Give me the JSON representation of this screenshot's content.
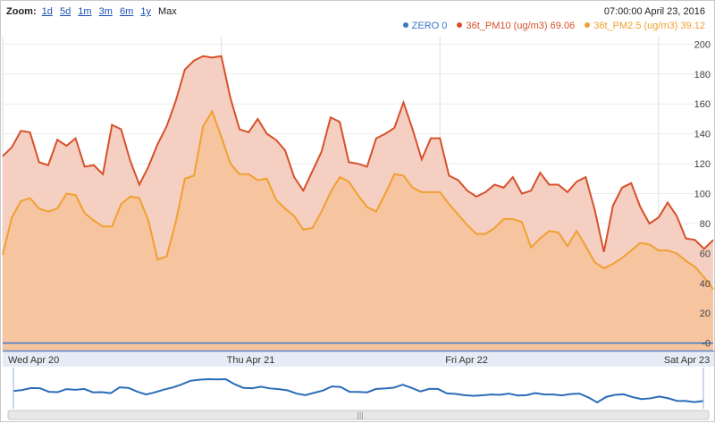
{
  "zoom": {
    "label": "Zoom:",
    "options": [
      "1d",
      "5d",
      "1m",
      "3m",
      "6m",
      "1y",
      "Max"
    ],
    "selected": "Max"
  },
  "readout": {
    "time": "07:00:00 April 23, 2016",
    "legend": [
      {
        "name": "ZERO",
        "value": "0",
        "color": "#3b78c8"
      },
      {
        "name": "36t_PM10 (ug/m3)",
        "value": "69.06",
        "color": "#d6512a"
      },
      {
        "name": "36t_PM2.5 (ug/m3)",
        "value": "39.12",
        "color": "#f0a030"
      }
    ]
  },
  "chart_data": {
    "type": "area",
    "ylim": [
      -5,
      205
    ],
    "yticks": [
      0,
      20,
      40,
      60,
      80,
      100,
      120,
      140,
      160,
      180,
      200
    ],
    "grid": true,
    "x_labels": [
      "Wed Apr 20",
      "Thu Apr 21",
      "Fri Apr 22",
      "Sat Apr 23"
    ],
    "x_label_index": [
      0,
      24,
      48,
      72
    ],
    "series": [
      {
        "name": "36t_PM10 (ug/m3)",
        "color": "#d6512a",
        "fill": "#f5cfc2",
        "values": [
          125,
          131,
          142,
          141,
          121,
          119,
          136,
          132,
          137,
          118,
          119,
          113,
          146,
          143,
          122,
          106,
          118,
          133,
          145,
          162,
          183,
          189,
          192,
          191,
          192,
          164,
          143,
          141,
          150,
          140,
          136,
          129,
          111,
          102,
          115,
          128,
          151,
          148,
          121,
          120,
          118,
          137,
          140,
          144,
          161,
          143,
          123,
          137,
          137,
          112,
          109,
          102,
          98,
          101,
          106,
          104,
          111,
          100,
          102,
          114,
          106,
          106,
          101,
          108,
          111,
          89,
          61,
          92,
          104,
          107,
          91,
          80,
          84,
          94,
          85,
          70,
          69,
          63,
          69
        ]
      },
      {
        "name": "36t_PM2.5 (ug/m3)",
        "color": "#f0a030",
        "fill": "#f7c4a0",
        "values": [
          59,
          84,
          95,
          97,
          90,
          88,
          90,
          100,
          99,
          87,
          82,
          78,
          78,
          93,
          98,
          97,
          82,
          56,
          58,
          81,
          110,
          112,
          145,
          155,
          138,
          120,
          113,
          113,
          109,
          110,
          96,
          90,
          85,
          76,
          77,
          88,
          101,
          111,
          108,
          99,
          91,
          88,
          100,
          113,
          112,
          104,
          101,
          101,
          101,
          93,
          86,
          79,
          73,
          73,
          77,
          83,
          83,
          81,
          64,
          70,
          75,
          74,
          65,
          75,
          65,
          54,
          50,
          53,
          57,
          62,
          67,
          66,
          62,
          62,
          60,
          55,
          51,
          44,
          36
        ]
      },
      {
        "name": "ZERO",
        "color": "#3b78c8",
        "values": [
          0
        ]
      }
    ]
  }
}
